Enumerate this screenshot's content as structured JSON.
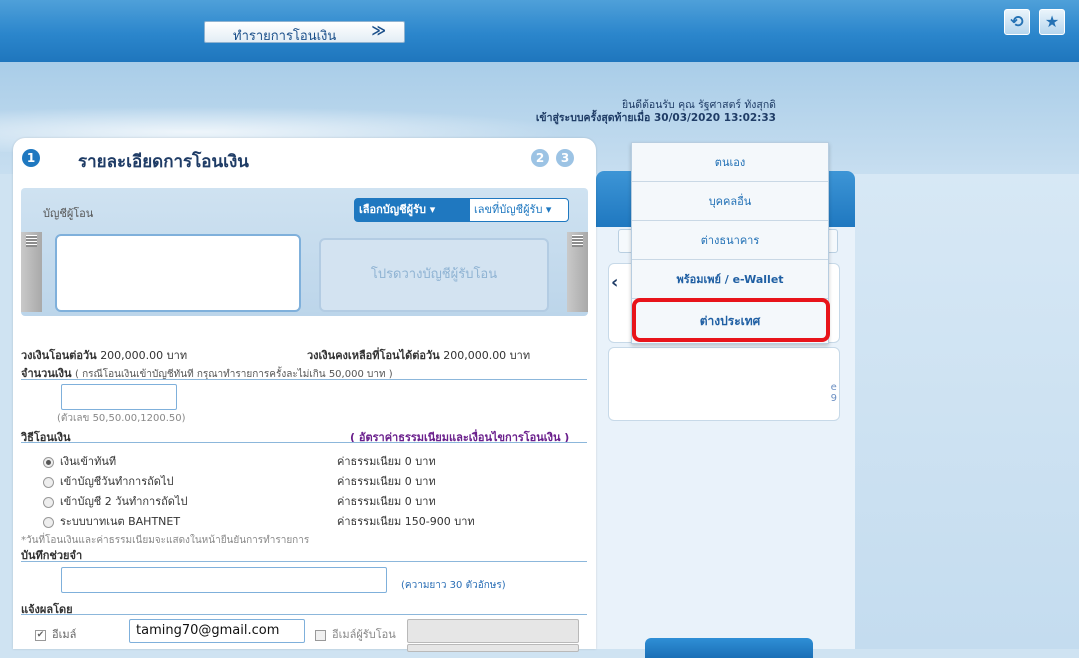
{
  "topbar": {
    "menu_select_label": "ทำรายการโอนเงิน",
    "menu_select_chevron": "≫",
    "logout_icon_glyph": "⟲",
    "favorite_icon_glyph": "★"
  },
  "banner": {
    "welcome_line1": "ยินดีต้อนรับ คุณ รัฐศาสตร์ ทังสุกดิ",
    "welcome_line2": "เข้าสู่ระบบครั้งสุดท้ายเมื่อ 30/03/2020 13:02:33"
  },
  "panel": {
    "step1": "1",
    "title": "รายละเอียดการโอนเงิน",
    "step2": "2",
    "step3": "3"
  },
  "accounts": {
    "from_label": "บัญชีผู้โอน",
    "select_recipient": "เลือกบัญชีผู้รับ ▾",
    "recipient_number": "เลขที่บัญชีผู้รับ ▾",
    "drop_placeholder": "โปรดวางบัญชีผู้รับโอน"
  },
  "limits": {
    "daily_label": "วงเงินโอนต่อวัน",
    "daily_value": "200,000.00 บาท",
    "remaining_label": "วงเงินคงเหลือที่โอนได้ต่อวัน",
    "remaining_value": "200,000.00 บาท"
  },
  "amount": {
    "label": "จำนวนเงิน",
    "hint": "( กรณีโอนเงินเข้าบัญชีทันที กรุณาทำรายการครั้งละไม่เกิน 50,000 บาท )",
    "example": "(ตัวเลข 50,50.00,1200.50)"
  },
  "method": {
    "label": "วิธีโอนเงิน",
    "fee_link": "( อัตราค่าธรรมเนียมและเงื่อนไขการโอนเงิน )",
    "options": [
      {
        "label": "เงินเข้าทันที",
        "fee": "ค่าธรรมเนียม 0 บาท"
      },
      {
        "label": "เข้าบัญชีวันทำการถัดไป",
        "fee": "ค่าธรรมเนียม 0 บาท"
      },
      {
        "label": "เข้าบัญชี 2 วันทำการถัดไป",
        "fee": "ค่าธรรมเนียม 0 บาท"
      },
      {
        "label": "ระบบบาทเนต BAHTNET",
        "fee": "ค่าธรรมเนียม 150-900 บาท"
      }
    ],
    "footnote": "*วันที่โอนเงินและค่าธรรมเนียมจะแสดงในหน้ายืนยันการทำรายการ"
  },
  "memo": {
    "label": "บันทึกช่วยจำ",
    "length_hint": "(ความยาว 30 ตัวอักษร)"
  },
  "notify": {
    "label": "แจ้งผลโดย",
    "email_label": "อีเมล์",
    "email_value": "taming70@gmail.com",
    "recipient_email_label": "อีเมล์ผู้รับโอน"
  },
  "dropdown": {
    "items": [
      "ตนเอง",
      "บุคคลอื่น",
      "ต่างธนาคาร",
      "พร้อมเพย์ / e-Wallet",
      "ต่างประเทศ"
    ]
  },
  "right_panel": {
    "arrow_glyph": "‹",
    "partial_text": "e\n9"
  },
  "colors": {
    "highlight": "#e8141a",
    "accent_blue": "#1f78c0"
  }
}
